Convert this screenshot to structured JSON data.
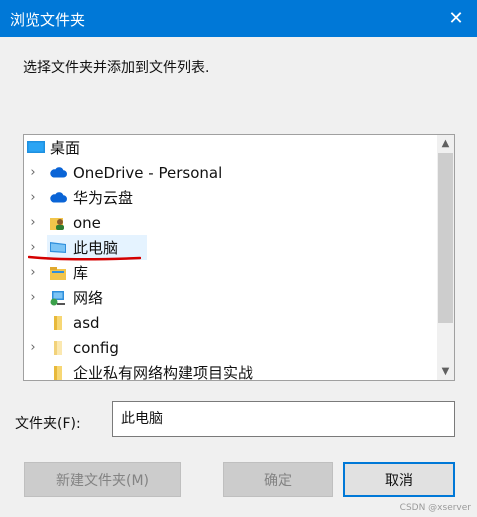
{
  "window": {
    "title": "浏览文件夹"
  },
  "instructions": "选择文件夹并添加到文件列表.",
  "tree": {
    "items": [
      {
        "label": "桌面",
        "icon": "desktop-icon",
        "expander": false,
        "level": 0
      },
      {
        "label": "OneDrive - Personal",
        "icon": "cloud-icon",
        "expander": true,
        "level": 1
      },
      {
        "label": "华为云盘",
        "icon": "cloud-icon",
        "expander": true,
        "level": 1
      },
      {
        "label": "one",
        "icon": "user-folder-icon",
        "expander": true,
        "level": 1
      },
      {
        "label": "此电脑",
        "icon": "computer-icon",
        "expander": true,
        "level": 1,
        "selected": true
      },
      {
        "label": "库",
        "icon": "library-icon",
        "expander": true,
        "level": 1
      },
      {
        "label": "网络",
        "icon": "network-icon",
        "expander": true,
        "level": 1
      },
      {
        "label": "asd",
        "icon": "folder-icon",
        "expander": false,
        "level": 1
      },
      {
        "label": "config",
        "icon": "folder-icon",
        "expander": true,
        "level": 1
      },
      {
        "label": "企业私有网络构建项目实战",
        "icon": "folder-icon",
        "expander": false,
        "level": 1
      }
    ]
  },
  "folder_field": {
    "label": "文件夹(F):",
    "value": "此电脑"
  },
  "buttons": {
    "new_folder": "新建文件夹(M)",
    "ok": "确定",
    "cancel": "取消"
  },
  "watermark": "CSDN @xserver",
  "colors": {
    "titlebar": "#0078d7",
    "selection": "#e5f3ff",
    "annotation": "#d40000"
  }
}
